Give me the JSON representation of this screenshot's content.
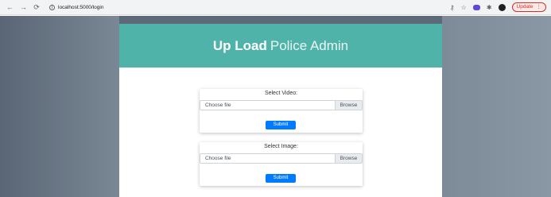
{
  "browser": {
    "url": "localhost:5000/login",
    "update_label": "Update"
  },
  "banner": {
    "brand_strong": "Up Load",
    "brand_light": "Police Admin"
  },
  "video_form": {
    "title": "Select Video:",
    "file_label": "Choose file",
    "browse_label": "Browse",
    "submit_label": "Submit"
  },
  "image_form": {
    "title": "Select Image:",
    "file_label": "Choose file",
    "browse_label": "Browse",
    "submit_label": "Submit"
  },
  "colors": {
    "banner": "#4fb3aa",
    "submit": "#007bff",
    "update_outline": "#d93025"
  }
}
